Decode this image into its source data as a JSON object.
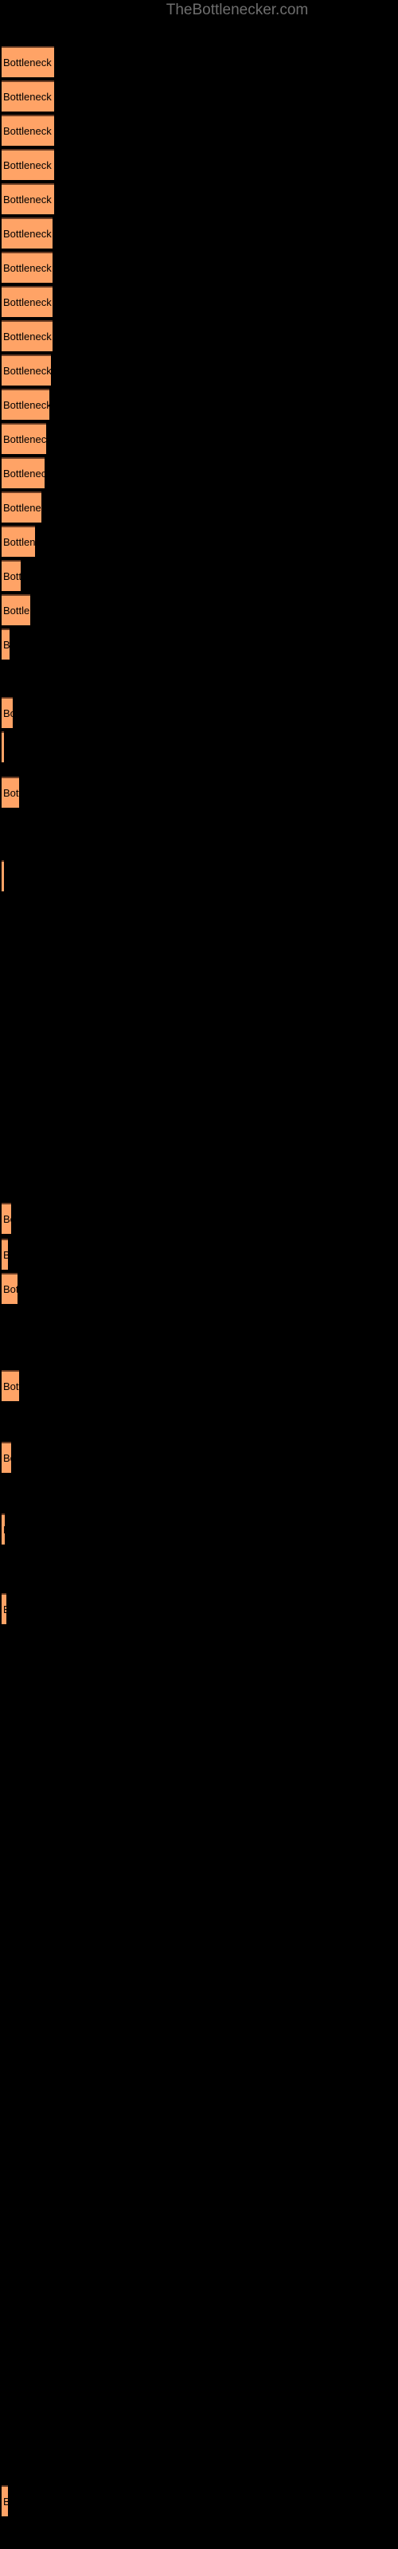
{
  "site": {
    "title": "TheBottlenecker.com",
    "title_color": "#6e6e6e",
    "background_color": "#000000"
  },
  "chart_data": {
    "type": "bar",
    "orientation": "horizontal",
    "title": "TheBottlenecker.com",
    "xlabel": "",
    "ylabel": "",
    "grid": false,
    "legend": false,
    "bar_color": "#ffa366",
    "bar_edge_color": "#6b3d24",
    "label_color": "#000000",
    "xlim": [
      0,
      500
    ],
    "bar_label_template": "Bottleneck result",
    "categories": [
      "Bottleneck result",
      "Bottleneck result",
      "Bottleneck result",
      "Bottleneck result",
      "Bottleneck result",
      "Bottleneck result",
      "Bottleneck result",
      "Bottleneck result",
      "Bottleneck result",
      "Bottleneck result",
      "Bottleneck result",
      "Bottleneck result",
      "Bottleneck result",
      "Bottleneck result",
      "Bottleneck result",
      "Bottleneck result",
      "Bottleneck result",
      "Bottleneck result",
      "Bottleneck result",
      "Bottleneck result",
      "Bottleneck result",
      "Bottleneck result",
      "Bottleneck result",
      "Bottleneck result",
      "Bottleneck result",
      "Bottleneck result",
      "Bottleneck result",
      "Bottleneck result",
      "Bottleneck result",
      "Bottleneck result",
      "Bottleneck result",
      "Bottleneck result",
      "Bottleneck result"
    ],
    "values": [
      66,
      66,
      66,
      66,
      66,
      64,
      64,
      64,
      64,
      62,
      60,
      56,
      54,
      50,
      42,
      24,
      36,
      10,
      4,
      26,
      0.5,
      22,
      0.5,
      14,
      0.5,
      18,
      12,
      20,
      24,
      26,
      4,
      10,
      0.5
    ],
    "bars": [
      {
        "y": 58,
        "width": 66,
        "label": "Bottleneck result"
      },
      {
        "y": 101,
        "width": 66,
        "label": "Bottleneck result"
      },
      {
        "y": 144,
        "width": 66,
        "label": "Bottleneck result"
      },
      {
        "y": 187,
        "width": 66,
        "label": "Bottleneck result"
      },
      {
        "y": 230,
        "width": 66,
        "label": "Bottleneck result"
      },
      {
        "y": 273,
        "width": 64,
        "label": "Bottleneck result"
      },
      {
        "y": 316,
        "width": 64,
        "label": "Bottleneck result"
      },
      {
        "y": 359,
        "width": 64,
        "label": "Bottleneck result"
      },
      {
        "y": 402,
        "width": 64,
        "label": "Bottleneck result"
      },
      {
        "y": 445,
        "width": 62,
        "label": "Bottleneck result"
      },
      {
        "y": 488,
        "width": 60,
        "label": "Bottleneck result"
      },
      {
        "y": 531,
        "width": 56,
        "label": "Bottleneck result"
      },
      {
        "y": 574,
        "width": 54,
        "label": "Bottleneck result"
      },
      {
        "y": 617,
        "width": 50,
        "label": "Bottleneck result"
      },
      {
        "y": 660,
        "width": 42,
        "label": "Bottleneck result"
      },
      {
        "y": 703,
        "width": 24,
        "label": "Bottleneck result"
      },
      {
        "y": 746,
        "width": 36,
        "label": "Bottleneck result"
      },
      {
        "y": 789,
        "width": 10,
        "label": "Bottleneck result"
      },
      {
        "y": 875,
        "width": 14,
        "label": "Bottleneck result"
      },
      {
        "y": 918,
        "width": 3,
        "label": "Bottleneck result"
      },
      {
        "y": 975,
        "width": 22,
        "label": "Bottleneck result"
      },
      {
        "y": 1080,
        "width": 3,
        "label": "Bottleneck result"
      },
      {
        "y": 1510,
        "width": 12,
        "label": "Bottleneck result"
      },
      {
        "y": 1555,
        "width": 8,
        "label": "Bottleneck result"
      },
      {
        "y": 1598,
        "width": 20,
        "label": "Bottleneck result"
      },
      {
        "y": 1720,
        "width": 22,
        "label": "Bottleneck result"
      },
      {
        "y": 1810,
        "width": 12,
        "label": "Bottleneck result"
      },
      {
        "y": 1900,
        "width": 4,
        "label": "Bottleneck result"
      },
      {
        "y": 2000,
        "width": 6,
        "label": "Bottleneck result"
      },
      {
        "y": 3120,
        "width": 8,
        "label": "Bottleneck result"
      }
    ]
  }
}
